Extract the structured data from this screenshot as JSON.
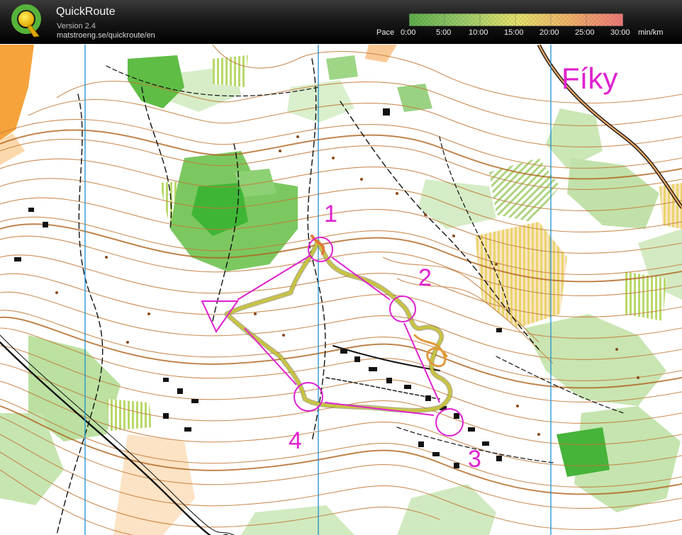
{
  "app": {
    "name": "QuickRoute",
    "version": "Version 2.4",
    "url": "matstroeng.se/quickroute/en"
  },
  "pace_legend": {
    "label": "Pace",
    "ticks": [
      "0:00",
      "5:00",
      "10:00",
      "15:00",
      "20:00",
      "25:00",
      "30:00"
    ],
    "unit": "min/km",
    "colors": [
      "#5fb04c",
      "#9bcc6a",
      "#e6e46d",
      "#f2b36a",
      "#f07a7a"
    ]
  },
  "map": {
    "area_name": "Fíky",
    "controls": [
      "1",
      "2",
      "3",
      "4"
    ],
    "course_color": "#e020d0",
    "route_color": "#c9c43a"
  }
}
